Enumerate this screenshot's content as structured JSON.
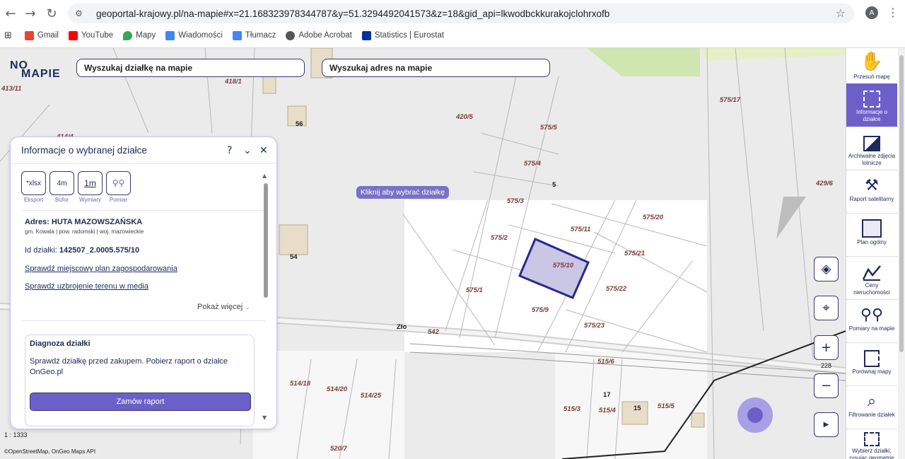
{
  "browser": {
    "url": "geoportal-krajowy.pl/na-mapie#x=21.168323978344787&y=51.3294492041573&z=18&gid_api=lkwodbckkurakojclohrxofb",
    "profile_initial": "A",
    "bookmarks": [
      {
        "label": "Gmail",
        "icon": "gmail-icon",
        "color": "#ea4335"
      },
      {
        "label": "YouTube",
        "icon": "youtube-icon",
        "color": "#ff0000"
      },
      {
        "label": "Mapy",
        "icon": "maps-pin-icon",
        "color": "#34a853"
      },
      {
        "label": "Wiadomości",
        "icon": "news-icon",
        "color": "#4285f4"
      },
      {
        "label": "Tłumacz",
        "icon": "translate-icon",
        "color": "#4285f4"
      },
      {
        "label": "Adobe Acrobat",
        "icon": "acrobat-icon",
        "color": "#555555"
      },
      {
        "label": "Statistics | Eurostat",
        "icon": "eu-flag-icon",
        "color": "#003399"
      }
    ]
  },
  "app": {
    "logo_top": "NO",
    "logo_bottom": "MAPIE",
    "search_plot": "Wyszukaj działkę na mapie",
    "search_address": "Wyszukaj adres na mapie",
    "tooltip": "Kliknij aby wybrać działkę",
    "zoom_value": "228",
    "scale": "1 : 1333",
    "attribution": "©OpenStreetMap, OnGeo Maps API"
  },
  "panel": {
    "title": "Informacje o wybranej działce",
    "tools": [
      {
        "value": "*xlsx",
        "label": "Eksport"
      },
      {
        "value": "4m",
        "label": "Bufor"
      },
      {
        "value": "1m",
        "label": "Wymiary"
      },
      {
        "value": "⚲⚲",
        "label": "Pomiar"
      }
    ],
    "address_label": "Adres: HUTA MAZOWSZAŃSKA",
    "address_sub": "gm. Kowala | pow. radomski | woj. mazowieckie",
    "id_label": "Id działki: ",
    "id_value": "142507_2.0005.575/10",
    "link_plan": "Sprawdź miejscowy plan zagospodarowania",
    "link_media": "Sprawdź uzbrojenie terenu w media",
    "more": "Pokaż więcej",
    "diag_title": "Diagnoza działki",
    "diag_text": "Sprawdź działkę przed zakupem. Pobierz raport o działce OnGeo.pl",
    "diag_button": "Zamów raport"
  },
  "plots": [
    "413/11",
    "418/1",
    "420/5",
    "575/5",
    "575/4",
    "575/3",
    "575/2",
    "575/1",
    "575/11",
    "575/10",
    "575/9",
    "575/20",
    "575/21",
    "575/22",
    "575/23",
    "575/17",
    "429/6",
    "414/4",
    "542",
    "515/6",
    "514/18",
    "514/20",
    "514/25",
    "515/3",
    "515/4",
    "515/5",
    "520/7",
    "56",
    "54",
    "17",
    "15",
    "5",
    "Zło"
  ],
  "sidebar": [
    {
      "label": "Przesuń mapę",
      "icon": "hand-icon",
      "active": false
    },
    {
      "label": "Informacje o działce",
      "icon": "plot-info-icon",
      "active": true
    },
    {
      "label": "Archiwalne zdjęcia lotnicze",
      "icon": "aerial-photo-icon",
      "active": false
    },
    {
      "label": "Raport satelitarny",
      "icon": "satellite-icon",
      "active": false
    },
    {
      "label": "Plan ogólny",
      "icon": "general-plan-icon",
      "active": false
    },
    {
      "label": "Ceny nieruchomości",
      "icon": "price-chart-icon",
      "active": false
    },
    {
      "label": "Pomiary na mapie",
      "icon": "measure-icon",
      "active": false
    },
    {
      "label": "Porównaj mapy",
      "icon": "compare-icon",
      "active": false
    },
    {
      "label": "Filtrowanie działek",
      "icon": "filter-map-icon",
      "active": false
    },
    {
      "label": "Wybierz działki, rysując geometrię",
      "icon": "draw-select-icon",
      "active": false
    }
  ],
  "colors": {
    "accent": "#6c60c8",
    "selected_plot_fill": "#c9c6e6",
    "selected_plot_stroke": "#2a2a8c",
    "plot_label": "#7a3a3a"
  }
}
